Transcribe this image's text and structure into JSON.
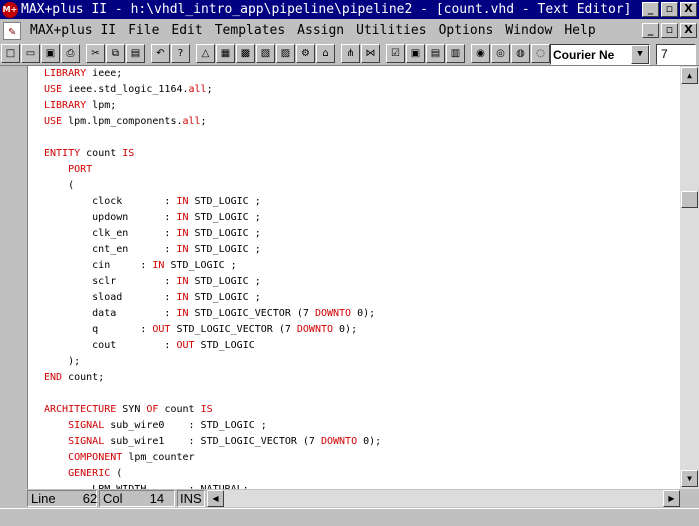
{
  "window": {
    "app_icon_label": "M+",
    "title": "MAX+plus II - h:\\vhdl_intro_app\\pipeline\\pipeline2 - [count.vhd - Text Editor]",
    "minimize": "_",
    "restore": "▫",
    "close": "X"
  },
  "menubar": {
    "icon": "✎",
    "items": [
      "MAX+plus II",
      "File",
      "Edit",
      "Templates",
      "Assign",
      "Utilities",
      "Options",
      "Window",
      "Help"
    ],
    "doc_minimize": "_",
    "doc_restore": "▫",
    "doc_close": "X"
  },
  "toolbar": {
    "buttons": [
      {
        "name": "new-icon",
        "glyph": "□"
      },
      {
        "name": "open-icon",
        "glyph": "▭"
      },
      {
        "name": "save-icon",
        "glyph": "▣"
      },
      {
        "name": "print-icon",
        "glyph": "⎙"
      },
      {
        "name": "cut-icon",
        "glyph": "✂"
      },
      {
        "name": "copy-icon",
        "glyph": "⧉"
      },
      {
        "name": "paste-icon",
        "glyph": "▤"
      },
      {
        "name": "undo-icon",
        "glyph": "↶"
      },
      {
        "name": "help-icon",
        "glyph": "?"
      },
      {
        "name": "hierarchy-icon",
        "glyph": "△"
      },
      {
        "name": "floorplan-icon",
        "glyph": "▦"
      },
      {
        "name": "compile-icon",
        "glyph": "▩"
      },
      {
        "name": "simulate-icon",
        "glyph": "▧"
      },
      {
        "name": "timing-icon",
        "glyph": "▨"
      },
      {
        "name": "program-icon",
        "glyph": "⚙"
      },
      {
        "name": "project-icon",
        "glyph": "⌂"
      },
      {
        "name": "tree-icon",
        "glyph": "⋔"
      },
      {
        "name": "network-icon",
        "glyph": "⋈"
      },
      {
        "name": "check-icon",
        "glyph": "☑"
      },
      {
        "name": "save-check-icon",
        "glyph": "▣"
      },
      {
        "name": "save-compile-icon",
        "glyph": "▤"
      },
      {
        "name": "save-simulate-icon",
        "glyph": "▥"
      },
      {
        "name": "find-icon",
        "glyph": "◉"
      },
      {
        "name": "replace-icon",
        "glyph": "◎"
      },
      {
        "name": "next-icon",
        "glyph": "◍"
      },
      {
        "name": "prev-icon",
        "glyph": "◌"
      }
    ],
    "font_value": "Courier Ne",
    "size_value": "7"
  },
  "code": [
    [
      {
        "t": "LIBRARY ",
        "k": true
      },
      {
        "t": "ieee;"
      }
    ],
    [
      {
        "t": "USE ",
        "k": true
      },
      {
        "t": "ieee.std_logic_1164."
      },
      {
        "t": "all",
        "k": true
      },
      {
        "t": ";"
      }
    ],
    [
      {
        "t": "LIBRARY ",
        "k": true
      },
      {
        "t": "lpm;"
      }
    ],
    [
      {
        "t": "USE ",
        "k": true
      },
      {
        "t": "lpm.lpm_components."
      },
      {
        "t": "all",
        "k": true
      },
      {
        "t": ";"
      }
    ],
    [],
    [
      {
        "t": "ENTITY ",
        "k": true
      },
      {
        "t": "count "
      },
      {
        "t": "IS",
        "k": true
      }
    ],
    [
      {
        "t": "    "
      },
      {
        "t": "PORT",
        "k": true
      }
    ],
    [
      {
        "t": "    ("
      }
    ],
    [
      {
        "t": "        clock       : "
      },
      {
        "t": "IN ",
        "k": true
      },
      {
        "t": "STD_LOGIC ;"
      }
    ],
    [
      {
        "t": "        updown      : "
      },
      {
        "t": "IN ",
        "k": true
      },
      {
        "t": "STD_LOGIC ;"
      }
    ],
    [
      {
        "t": "        clk_en      : "
      },
      {
        "t": "IN ",
        "k": true
      },
      {
        "t": "STD_LOGIC ;"
      }
    ],
    [
      {
        "t": "        cnt_en      : "
      },
      {
        "t": "IN ",
        "k": true
      },
      {
        "t": "STD_LOGIC ;"
      }
    ],
    [
      {
        "t": "        cin     : "
      },
      {
        "t": "IN ",
        "k": true
      },
      {
        "t": "STD_LOGIC ;"
      }
    ],
    [
      {
        "t": "        sclr        : "
      },
      {
        "t": "IN ",
        "k": true
      },
      {
        "t": "STD_LOGIC ;"
      }
    ],
    [
      {
        "t": "        sload       : "
      },
      {
        "t": "IN ",
        "k": true
      },
      {
        "t": "STD_LOGIC ;"
      }
    ],
    [
      {
        "t": "        data        : "
      },
      {
        "t": "IN ",
        "k": true
      },
      {
        "t": "STD_LOGIC_VECTOR (7 "
      },
      {
        "t": "DOWNTO",
        "k": true
      },
      {
        "t": " 0);"
      }
    ],
    [
      {
        "t": "        q       : "
      },
      {
        "t": "OUT ",
        "k": true
      },
      {
        "t": "STD_LOGIC_VECTOR (7 "
      },
      {
        "t": "DOWNTO",
        "k": true
      },
      {
        "t": " 0);"
      }
    ],
    [
      {
        "t": "        cout        : "
      },
      {
        "t": "OUT ",
        "k": true
      },
      {
        "t": "STD_LOGIC"
      }
    ],
    [
      {
        "t": "    );"
      }
    ],
    [
      {
        "t": "END ",
        "k": true
      },
      {
        "t": "count;"
      }
    ],
    [],
    [
      {
        "t": "ARCHITECTURE ",
        "k": true
      },
      {
        "t": "SYN "
      },
      {
        "t": "OF ",
        "k": true
      },
      {
        "t": "count "
      },
      {
        "t": "IS",
        "k": true
      }
    ],
    [
      {
        "t": "    "
      },
      {
        "t": "SIGNAL ",
        "k": true
      },
      {
        "t": "sub_wire0    : STD_LOGIC ;"
      }
    ],
    [
      {
        "t": "    "
      },
      {
        "t": "SIGNAL ",
        "k": true
      },
      {
        "t": "sub_wire1    : STD_LOGIC_VECTOR (7 "
      },
      {
        "t": "DOWNTO",
        "k": true
      },
      {
        "t": " 0);"
      }
    ],
    [
      {
        "t": "    "
      },
      {
        "t": "COMPONENT ",
        "k": true
      },
      {
        "t": "lpm_counter"
      }
    ],
    [
      {
        "t": "    "
      },
      {
        "t": "GENERIC ",
        "k": true
      },
      {
        "t": "("
      }
    ],
    [
      {
        "t": "        LPM_WIDTH       : NATURAL;"
      }
    ]
  ],
  "status": {
    "line_label": "Line",
    "line_value": "62",
    "col_label": "Col",
    "col_value": "14",
    "mode": "INS"
  },
  "scroll": {
    "up": "▲",
    "down": "▼",
    "left": "◀",
    "right": "▶"
  }
}
